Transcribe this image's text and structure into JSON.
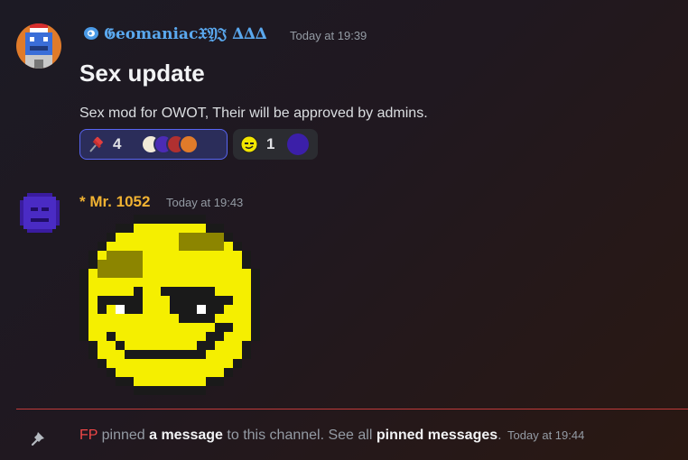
{
  "message1": {
    "username": "𝕲eomaniac𝔛𝔜𝔍 ∆∆∆",
    "timestamp": "Today at 19:39",
    "heading": "Sex update",
    "body": "Sex mod for OWOT, Their will be approved by admins.",
    "reactions": [
      {
        "emoji": "pushpin-icon",
        "count": "4"
      },
      {
        "emoji": "smirk-face-icon",
        "count": "1"
      }
    ]
  },
  "message2": {
    "username": "* Mr. 1052",
    "timestamp": "Today at 19:43",
    "attachment": "pixel-smirk-emoji"
  },
  "system": {
    "actor": "FP",
    "pinned": "pinned",
    "a_message": "a message",
    "to_channel": "to this channel. See all",
    "pinned_messages": "pinned messages",
    "period": ".",
    "timestamp": "Today at 19:44"
  },
  "colors": {
    "accent": "#5865f2",
    "username1": "#5aa8ee",
    "username2": "#f0b232",
    "system_actor": "#f04747"
  }
}
